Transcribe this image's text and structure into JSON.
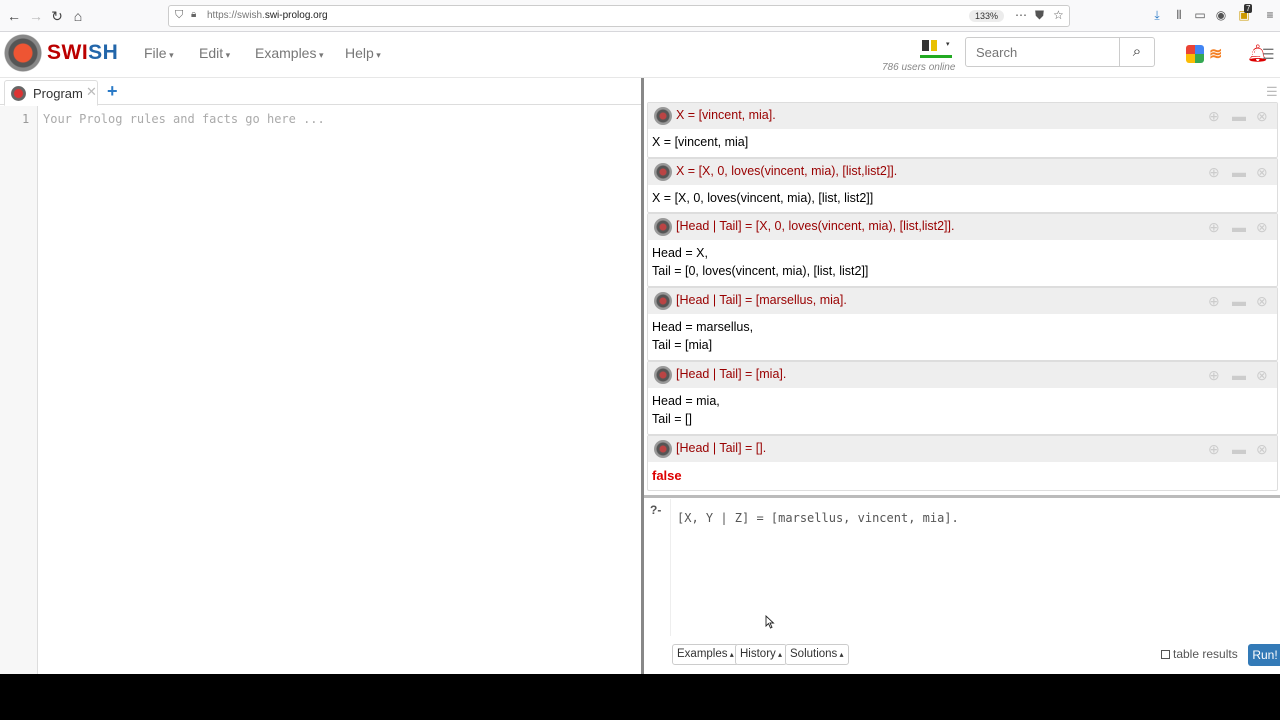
{
  "browser": {
    "url_prefix": "https://swish.",
    "url_domain": "swi-prolog.org",
    "zoom": "133%",
    "download_count": "7"
  },
  "navbar": {
    "logo": "SWISH",
    "menus": [
      "File",
      "Edit",
      "Examples",
      "Help"
    ],
    "users_online": "786 users online",
    "search_placeholder": "Search",
    "notification_count": "28"
  },
  "editor": {
    "tab_label": "Program",
    "line_number": "1",
    "placeholder": "Your Prolog rules and facts go here ..."
  },
  "queries": [
    {
      "query": "X = [vincent, mia].",
      "answers": [
        "X = [vincent, mia]"
      ]
    },
    {
      "query": "X = [X, 0, loves(vincent, mia), [list,list2]].",
      "answers": [
        "X = [X, 0, loves(vincent, mia), [list, list2]]"
      ]
    },
    {
      "query": "[Head | Tail] = [X, 0, loves(vincent, mia), [list,list2]].",
      "answers": [
        "Head = X,",
        "Tail = [0, loves(vincent, mia), [list, list2]]"
      ]
    },
    {
      "query": "[Head | Tail] = [marsellus, mia].",
      "answers": [
        "Head = marsellus,",
        "Tail = [mia]"
      ]
    },
    {
      "query": "[Head | Tail] = [mia].",
      "answers": [
        "Head = mia,",
        "Tail = []"
      ]
    },
    {
      "query": "[Head | Tail] = [].",
      "answers": [
        "false"
      ]
    }
  ],
  "query_editor": {
    "prompt": "?-",
    "code": "[X, Y | Z] = [marsellus, vincent, mia]."
  },
  "query_buttons": {
    "examples": "Examples",
    "history": "History",
    "solutions": "Solutions",
    "table_results": "table results",
    "run": "Run!"
  }
}
